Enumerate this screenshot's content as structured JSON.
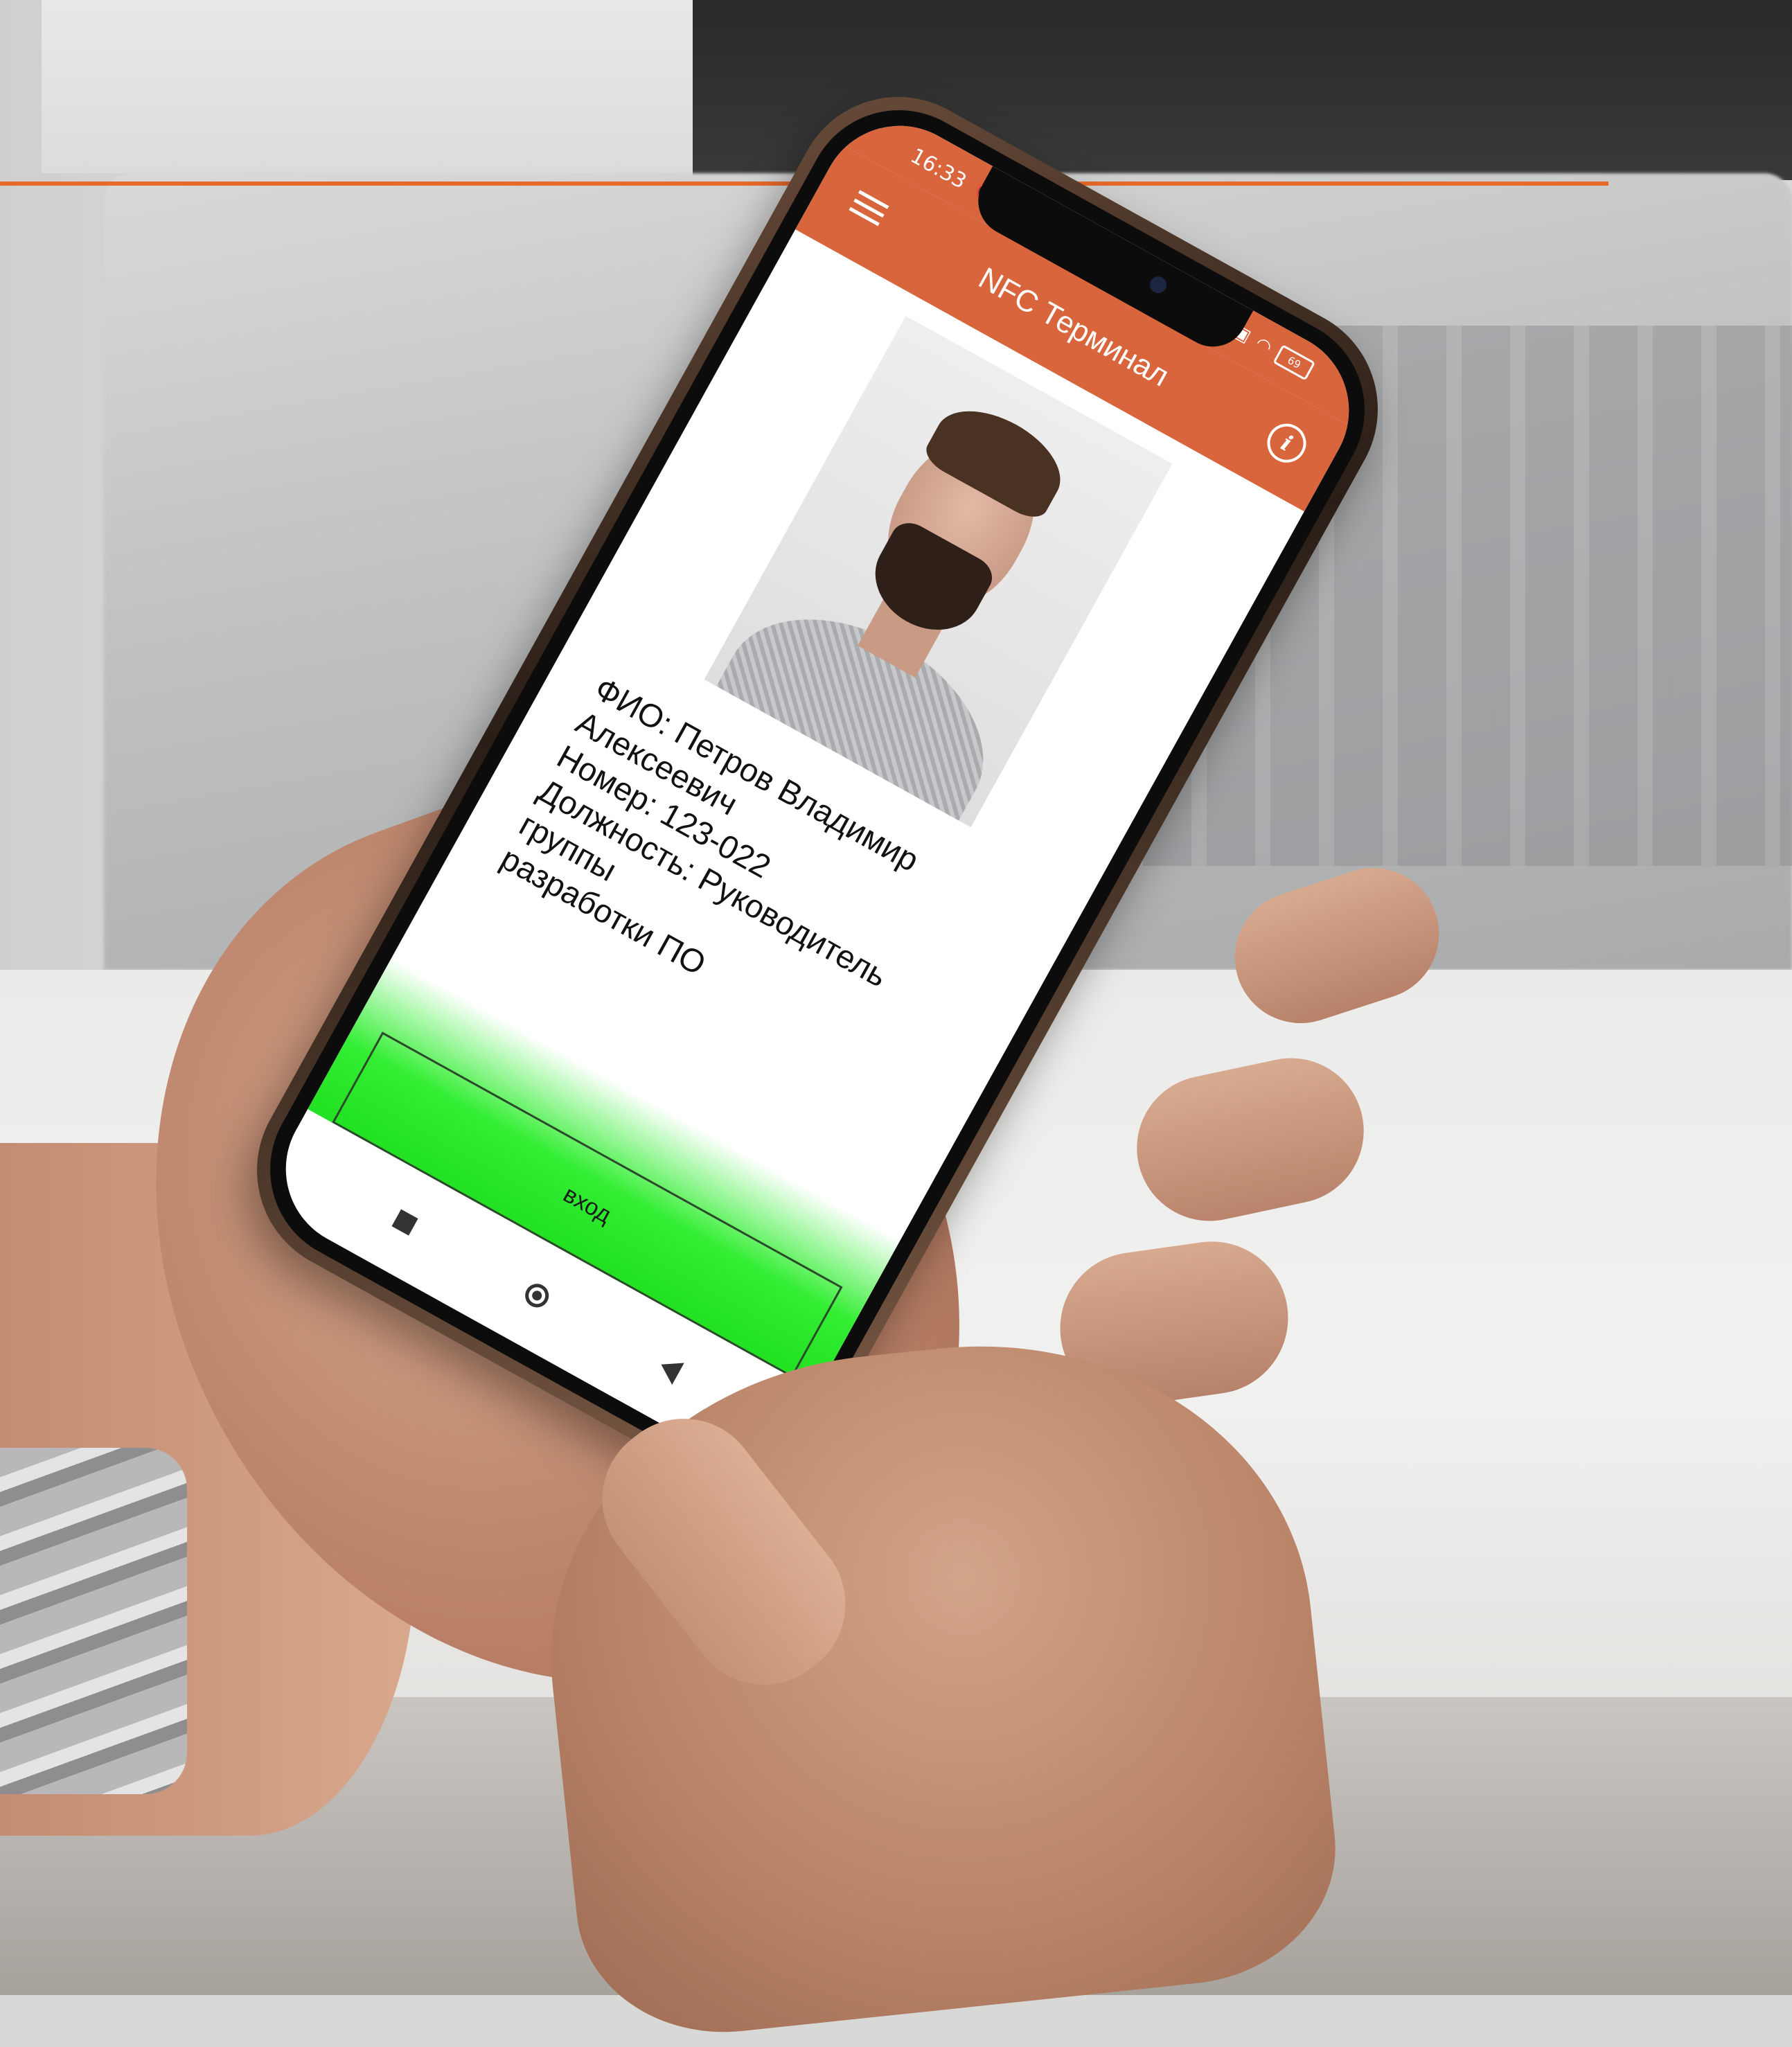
{
  "status_bar": {
    "time": "16:33",
    "left_icons": "⏰ ↓",
    "wifi_icon": "wifi-icon",
    "battery_level": "69"
  },
  "app_bar": {
    "title": "NFC Терминал",
    "menu_icon": "hamburger-menu-icon",
    "info_icon": "info-icon",
    "accent_color": "#d9653d"
  },
  "employee": {
    "full_name_line1": "ФИО: Петров Владимир",
    "full_name_line2": "Алексеевич",
    "number": "Номер: 123-022",
    "position_line1": "Должность: Руководитель группы",
    "position_line2": "разработки ПО"
  },
  "action": {
    "entry_label": "вход",
    "status_color": "#22e022"
  },
  "nav_bar": {
    "recent_icon": "square-recent-apps-icon",
    "home_icon": "circle-home-icon",
    "back_icon": "triangle-back-icon"
  },
  "decor": {
    "accent_line_color": "#e8692a"
  }
}
